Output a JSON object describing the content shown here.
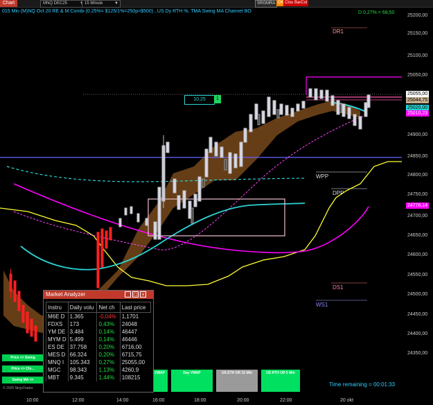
{
  "toolbar": {
    "chart_tab": "Chart",
    "instrument": "MNQ DEC25",
    "timeframe": "15 Minute",
    "btn_strat": "SRGMRA",
    "btn_ok": "OK",
    "btn_cloud": "Cloud",
    "btn_barcol": "BarCol"
  },
  "chart": {
    "title": "015 Min (M)NQ Oct 20 RE & M Combi (0.25%= $125/1%=250p=$500) , US Dy RTH %, TMA Swing MA Channel BO",
    "pnl": "D 0,27% = 68,50",
    "time_remaining": "Time remaining = 00:01:33",
    "copyright": "© 2025 NinjaTrader",
    "stop_value": "10,25",
    "stop_qty": "1",
    "levels": {
      "dr1": "DR1",
      "wpp": "WPP",
      "dpp": "DPP",
      "ds1": "DS1",
      "ws1": "WS1"
    },
    "price_tags": {
      "last": "25055,00",
      "p2": "25044,75",
      "p3": "25020,00",
      "p4": "25010,23",
      "p5": "24776,14"
    },
    "colors": {
      "cyan": "#2bd4d4",
      "magenta": "#ff00ff",
      "yellow": "#ffff33",
      "pink": "#ff55aa",
      "cloud": "#7a4a20",
      "green": "#00e060",
      "red": "#ff2020",
      "white_candle": "#d8d8e8",
      "blue_line": "#6666ff"
    }
  },
  "y_axis": [
    "25200,00",
    "25150,00",
    "25100,00",
    "25050,00",
    "25000,00",
    "24950,00",
    "24900,00",
    "24850,00",
    "24800,00",
    "24750,00",
    "24700,00",
    "24650,00",
    "24600,00",
    "24550,00",
    "24500,00",
    "24450,00",
    "24400,00",
    "24350,00"
  ],
  "x_axis": [
    "10:00",
    "12:00",
    "14:00",
    "16:00",
    "18:00",
    "20:00",
    "22:00",
    "20 okt"
  ],
  "buttons": {
    "left": [
      "Price <> Swing",
      "Price <> Clo...",
      "Swing MA <>"
    ],
    "bottom": [
      "...VWAP",
      "Day VWAP",
      "US ETH OR 15 Min",
      "US RTH OR 5 Min"
    ]
  },
  "market_analyzer": {
    "title": "Market Analyzer",
    "headers": [
      "Instru",
      "Daily volu",
      "Net ch",
      "Last price"
    ],
    "rows": [
      {
        "inst": "M6E D",
        "vol": "1.365",
        "net": "-0,04%",
        "last": "1,1701",
        "neg": true
      },
      {
        "inst": "FDXS",
        "vol": "173",
        "net": "0,43%",
        "last": "24048",
        "neg": false
      },
      {
        "inst": "YM DE",
        "vol": "3.484",
        "net": "0,14%",
        "last": "46447",
        "neg": false
      },
      {
        "inst": "MYM D",
        "vol": "5.499",
        "net": "0,14%",
        "last": "46446",
        "neg": false
      },
      {
        "inst": "ES DE",
        "vol": "37.758",
        "net": "0,20%",
        "last": "6716,00",
        "neg": false
      },
      {
        "inst": "MES D",
        "vol": "66.324",
        "net": "0,20%",
        "last": "6715,75",
        "neg": false
      },
      {
        "inst": "MNQ I",
        "vol": "105.343",
        "net": "0,27%",
        "last": "25055,00",
        "neg": false
      },
      {
        "inst": "MGC",
        "vol": "98.343",
        "net": "1,13%",
        "last": "4260,9",
        "neg": false
      },
      {
        "inst": "MBT",
        "vol": "9.345",
        "net": "1,44%",
        "last": "108215",
        "neg": false
      }
    ]
  }
}
